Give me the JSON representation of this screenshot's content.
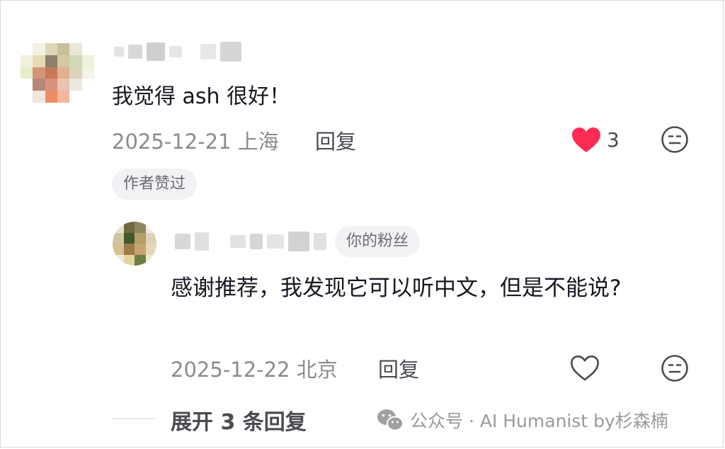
{
  "comment": {
    "text": "我觉得 ash 很好！",
    "date": "2025-12-21",
    "location": "上海",
    "reply_label": "回复",
    "like_count": "3",
    "liked": true,
    "author_badge": "作者赞过",
    "like_color": "#fe2c55"
  },
  "reply": {
    "fan_badge": "你的粉丝",
    "text": "感谢推荐，我发现它可以听中文，但是不能说?",
    "date": "2025-12-22",
    "location": "北京",
    "reply_label": "回复"
  },
  "expand": {
    "label": "展开 3 条回复"
  },
  "watermark": {
    "text": "公众号 · AI Humanist by杉森楠",
    "icon": "wechat-icon"
  },
  "icons": {
    "like_filled": "heart-filled-icon",
    "like_outline": "heart-outline-icon",
    "dislike": "meh-face-icon"
  }
}
